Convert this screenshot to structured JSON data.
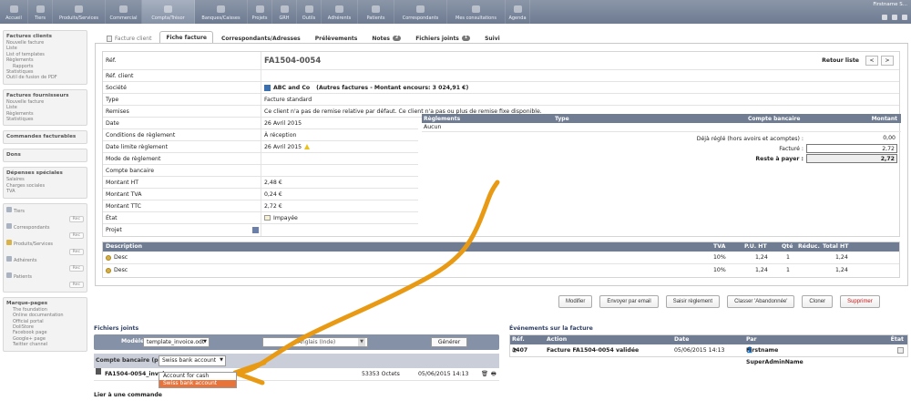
{
  "topbar": {
    "menu": [
      "Accueil",
      "Tiers",
      "Produits/Services",
      "Commercial",
      "Compta/Trésor",
      "Banques/Caisses",
      "Projets",
      "GRH",
      "Outils",
      "Adhérents",
      "Patients",
      "Correspondants",
      "Mes consultations",
      "Agenda"
    ],
    "user": "Firstname S..."
  },
  "sidebar": {
    "blocks": [
      {
        "title": "Factures clients",
        "items": [
          "Nouvelle facture",
          "Liste",
          "List of templates",
          "Règlements",
          "Rapports",
          "Statistiques",
          "Outil de fusion de PDF"
        ]
      },
      {
        "title": "Factures fournisseurs",
        "items": [
          "Nouvelle facture",
          "Liste",
          "Règlements",
          "Statistiques"
        ]
      },
      {
        "title": "Commandes facturables",
        "items": []
      },
      {
        "title": "Dons",
        "items": []
      },
      {
        "title": "Dépenses spéciales",
        "items": [
          "Salaires",
          "Charges sociales",
          "TVA"
        ]
      }
    ],
    "search": [
      {
        "label": "Tiers",
        "btn": "Rec"
      },
      {
        "label": "Correspondants",
        "btn": "Rec"
      },
      {
        "label": "Produits/Services",
        "btn": "Rec"
      },
      {
        "label": "Adhérents",
        "btn": "Rec"
      },
      {
        "label": "Patients",
        "btn": "Rec"
      }
    ],
    "links": {
      "title": "Marque-pages",
      "items": [
        "The foundation",
        "Online documentation",
        "Official portal",
        "DoliStore",
        "Facebook page",
        "Google+ page",
        "Twitter channel"
      ]
    }
  },
  "tabs": [
    {
      "label": "Facture client"
    },
    {
      "label": "Fiche facture"
    },
    {
      "label": "Correspondants/Adresses"
    },
    {
      "label": "Prélèvements"
    },
    {
      "label": "Notes",
      "badge": "2"
    },
    {
      "label": "Fichiers joints",
      "badge": "1"
    },
    {
      "label": "Suivi"
    }
  ],
  "invoice": {
    "nav": {
      "back": "Retour liste",
      "prev": "<",
      "next": ">"
    },
    "fields": {
      "ref_label": "Réf.",
      "ref_value": "FA1504-0054",
      "refclient_label": "Réf. client",
      "societe_label": "Société",
      "societe_name": "ABC and Co",
      "societe_note": "(Autres factures - Montant encours: 3 024,91 €)",
      "type_label": "Type",
      "type_value": "Facture standard",
      "remises_label": "Remises",
      "remises_value": "Ce client n'a pas de remise relative par défaut. Ce client n'a pas ou plus de remise fixe disponible.",
      "date_label": "Date",
      "date_value": "26 Avril 2015",
      "cond_label": "Conditions de règlement",
      "cond_value": "À réception",
      "limite_label": "Date limite règlement",
      "limite_value": "26 Avril 2015",
      "mode_label": "Mode de règlement",
      "compte_label": "Compte bancaire",
      "ht_label": "Montant HT",
      "ht_value": "2,48 €",
      "tva_label": "Montant TVA",
      "tva_value": "0,24 €",
      "ttc_label": "Montant TTC",
      "ttc_value": "2,72 €",
      "etat_label": "État",
      "etat_value": "Impayée",
      "projet_label": "Projet"
    },
    "payments": {
      "headers": {
        "reglements": "Règlements",
        "type": "Type",
        "compte": "Compte bancaire",
        "montant": "Montant"
      },
      "empty": "Aucun",
      "deja_label": "Déjà réglé (hors avoirs et acomptes) :",
      "deja_value": "0,00",
      "facture_label": "Facturé :",
      "facture_value": "2,72",
      "reste_label": "Reste à payer :",
      "reste_value": "2,72"
    },
    "lines": {
      "headers": {
        "desc": "Description",
        "tva": "TVA",
        "pu": "P.U. HT",
        "qty": "Qté",
        "reduc": "Réduc.",
        "total": "Total HT"
      },
      "rows": [
        {
          "desc": "Desc",
          "tva": "10%",
          "pu": "1,24",
          "qty": "1",
          "total": "1,24"
        },
        {
          "desc": "Desc",
          "tva": "10%",
          "pu": "1,24",
          "qty": "1",
          "total": "1,24"
        }
      ]
    },
    "actions": [
      "Modifier",
      "Envoyer par email",
      "Saisir règlement",
      "Classer 'Abandonnée'",
      "Cloner",
      "Supprimer"
    ]
  },
  "files": {
    "title": "Fichiers joints",
    "modele_label": "Modèle",
    "modele_value": "template_invoice.odt",
    "lang_value": "Anglais (Inde)",
    "generate_label": "Générer",
    "compte_label": "Compte bancaire (pdf)",
    "compte_value": "Swiss bank account",
    "options": [
      "Account for cash",
      "Swiss bank account"
    ],
    "file": {
      "name": "FA1504-0054_invoi...",
      "size": "53353 Octets",
      "date": "05/06/2015 14:13"
    },
    "lier": "Lier à une commande"
  },
  "events": {
    "title": "Événements sur la facture",
    "headers": {
      "ref": "Réf.",
      "action": "Action",
      "date": "Date",
      "par": "Par",
      "etat": "État"
    },
    "rows": [
      {
        "ref": "1407",
        "action": "Facture FA1504-0054 validée",
        "date": "05/06/2015 14:13",
        "par": "Firstname SuperAdminName"
      }
    ]
  },
  "colors": {
    "accent": "#6f7c92",
    "arrow": "#e89a14",
    "selected_option": "#e8743b",
    "delete": "#c01a1a"
  }
}
